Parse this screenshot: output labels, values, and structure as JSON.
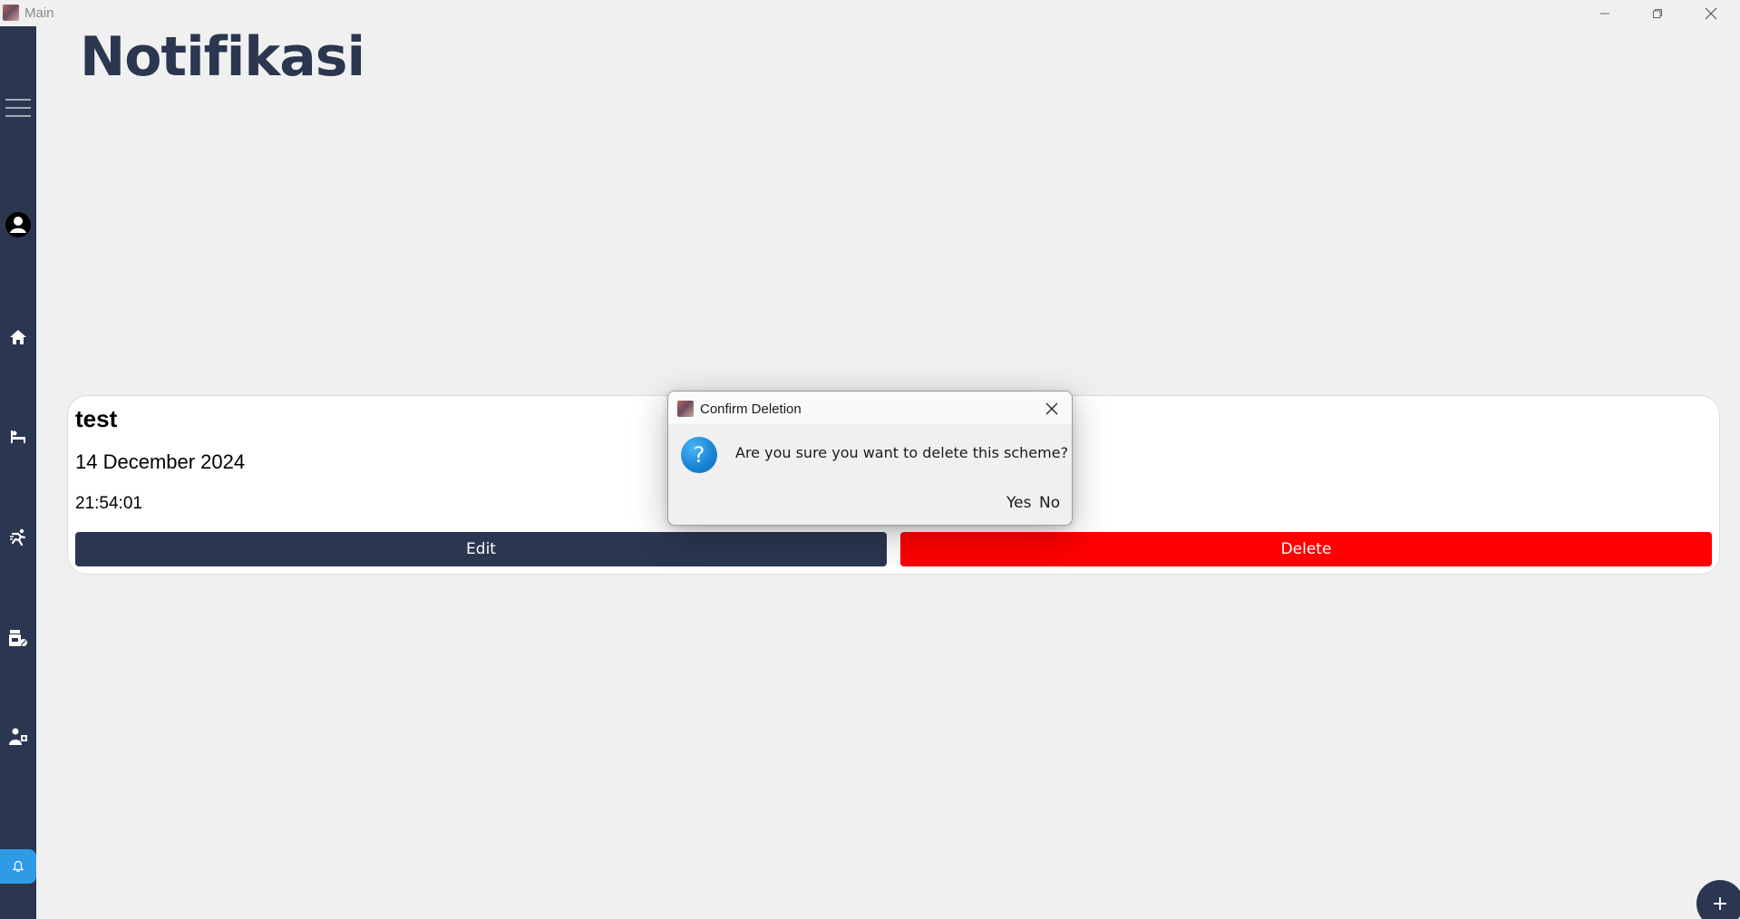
{
  "window": {
    "title": "Main",
    "controls": {
      "minimize": "minimize-icon",
      "restore": "restore-icon",
      "close": "close-icon"
    }
  },
  "sidebar": {
    "items": [
      {
        "id": "menu",
        "icon": "hamburger-menu-icon"
      },
      {
        "id": "profile",
        "icon": "user-circle-icon"
      },
      {
        "id": "home",
        "icon": "home-icon"
      },
      {
        "id": "rest",
        "icon": "bed-icon"
      },
      {
        "id": "activity",
        "icon": "running-icon"
      },
      {
        "id": "medicine",
        "icon": "medicine-icon"
      },
      {
        "id": "doctor",
        "icon": "doctor-icon"
      },
      {
        "id": "notifications",
        "icon": "bell-icon",
        "active": true
      }
    ],
    "colors": {
      "background": "#2b3650",
      "active": "#2f9be6"
    }
  },
  "page": {
    "title": "Notifikasi"
  },
  "notification": {
    "title": "test",
    "date": "14 December 2024",
    "time": "21:54:01",
    "edit_label": "Edit",
    "delete_label": "Delete",
    "colors": {
      "edit": "#2b3650",
      "delete": "#ff0000"
    }
  },
  "dialog": {
    "title": "Confirm Deletion",
    "icon": "question-icon",
    "message": "Are you sure you want to delete this scheme?",
    "yes_label": "Yes",
    "no_label": "No"
  },
  "fab": {
    "label": "+"
  }
}
